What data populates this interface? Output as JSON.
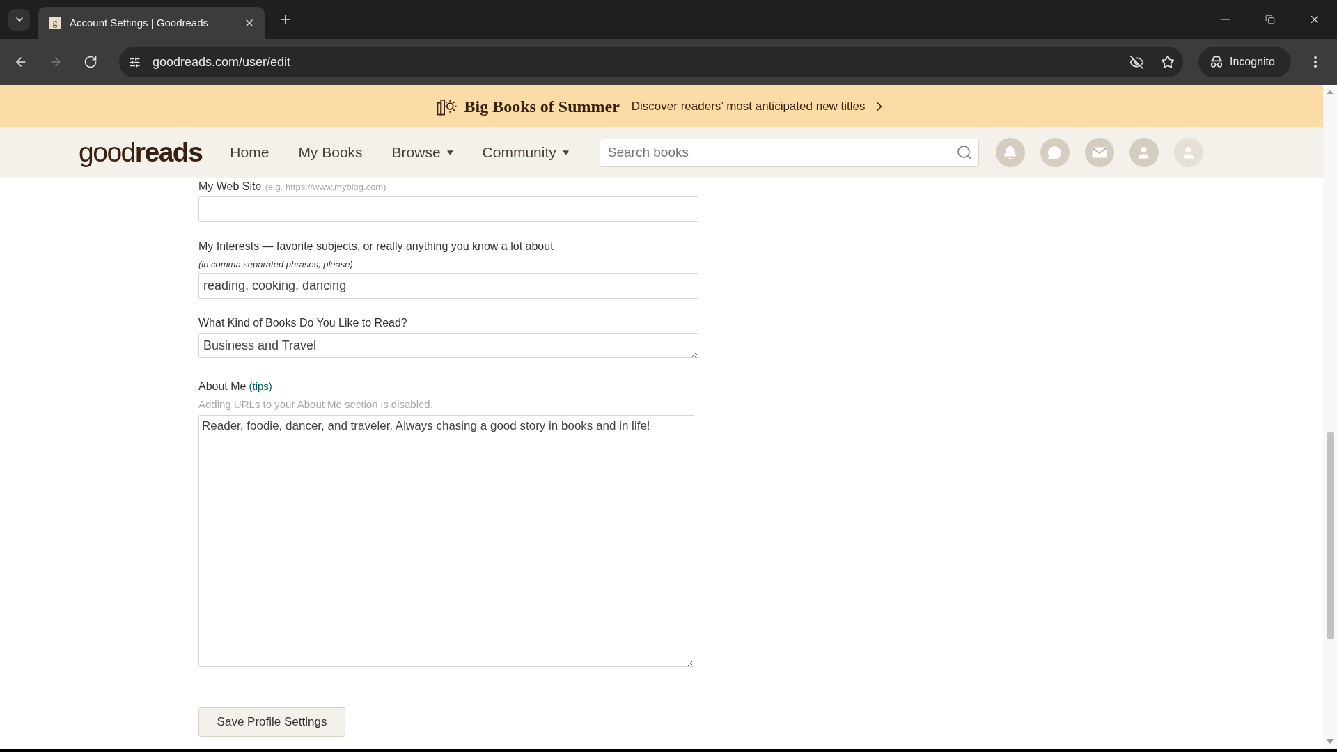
{
  "browser": {
    "tabs": [
      {
        "favicon": "g",
        "title": "Account Settings | Goodreads",
        "selected": true
      }
    ],
    "nav_buttons": [
      {
        "kind": "back",
        "disabled": false
      },
      {
        "kind": "forward",
        "disabled": true
      },
      {
        "kind": "reload",
        "disabled": false
      }
    ],
    "address": "goodreads.com/user/edit",
    "profile": "Incognito"
  },
  "banner": {
    "title": "Big Books of Summer",
    "text": "Discover readers’ most anticipated new titles"
  },
  "nav": {
    "logo": "good**reads**",
    "links": [
      {
        "label": "Home",
        "dropdown": false
      },
      {
        "label": "My Books",
        "dropdown": false
      },
      {
        "label": "Browse",
        "dropdown": true
      },
      {
        "label": "Community",
        "dropdown": true
      }
    ],
    "search": {
      "placeholder": "Search books"
    }
  },
  "form": {
    "fields": [
      {
        "kind": "text",
        "label": "My Web Site",
        "hint": "(e.g. https://www.myblog.com)"
      },
      {
        "kind": "text",
        "label": "My Interests — favorite subjects, or really anything you know a lot about",
        "instruction": "(in comma separated phrases, please)",
        "value": "reading, cooking, dancing"
      },
      {
        "kind": "short_text",
        "label": "What Kind of Books Do You Like to Read?",
        "value": "Business and Travel"
      },
      {
        "kind": "long_text",
        "label": "About Me",
        "link": "(tips)",
        "notice": "Adding URLs to your About Me section is disabled.",
        "value": "Reader, foodie, dancer, and traveler. Always chasing a good story in books and in life!"
      }
    ],
    "submit": "Save Profile Settings"
  }
}
